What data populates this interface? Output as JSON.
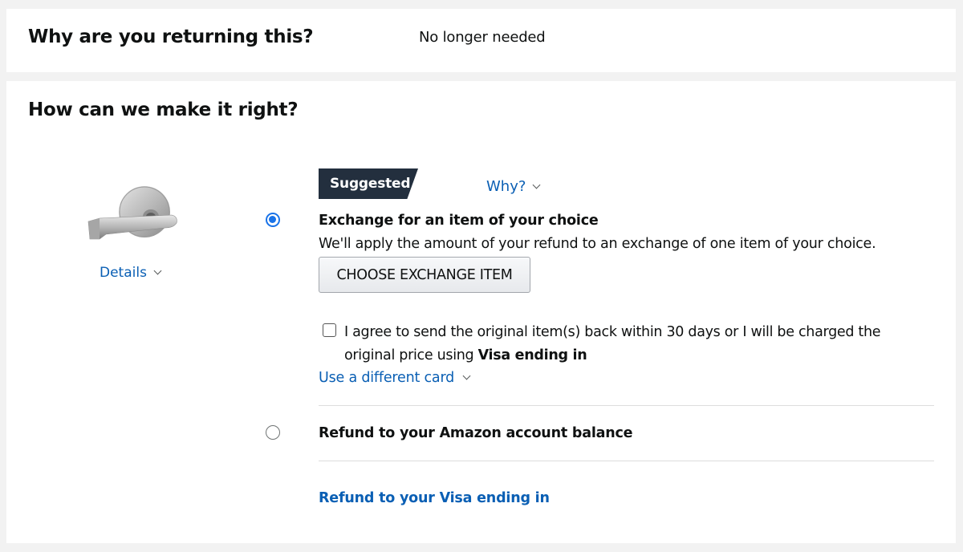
{
  "reason_section": {
    "title": "Why are you returning this?",
    "value": "No longer needed"
  },
  "resolution_section": {
    "title": "How can we make it right?",
    "product": {
      "image_icon": "door-lever-handle-image",
      "details_label": "Details"
    },
    "suggested_badge": "Suggested",
    "why_label": "Why?",
    "options": [
      {
        "title": "Exchange for an item of your choice",
        "description": "We'll apply the amount of your refund to an exchange of one item of your choice.",
        "selected": true,
        "button_label": "CHOOSE EXCHANGE ITEM",
        "agreement": {
          "checked": false,
          "text": "I agree to send the original item(s) back within 30 days or I will be charged the original price using ",
          "bold_text": "Visa ending in"
        },
        "card_link": "Use a different card"
      },
      {
        "title": "Refund to your Amazon account balance",
        "selected": false
      }
    ],
    "visa_refund_link": "Refund to your Visa ending in"
  },
  "colors": {
    "link": "#0a5fb4",
    "badge_bg": "#232f3e",
    "radio_selected": "#1a73e8",
    "page_bg": "#f2f2f2"
  }
}
